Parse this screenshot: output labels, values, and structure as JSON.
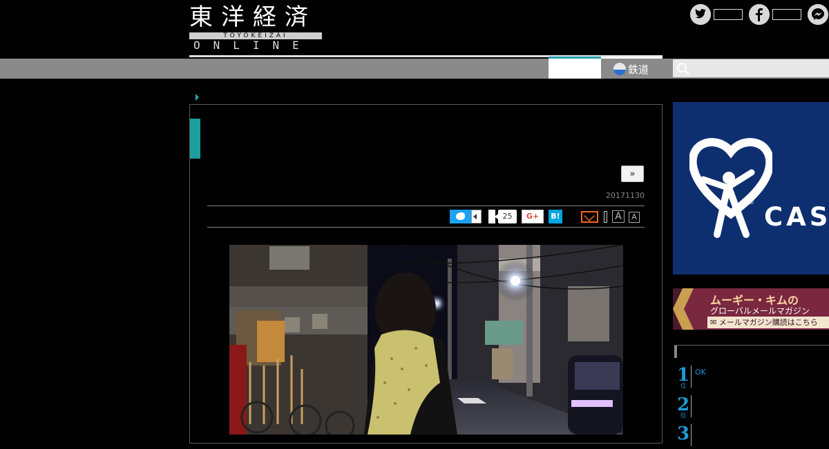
{
  "site": {
    "logo_kanji": "東洋経済",
    "logo_band": "TOYOKEIZAI",
    "logo_online": "ONLINE"
  },
  "social": {
    "twitter_icon": "twitter-icon",
    "facebook_icon": "facebook-icon",
    "messenger_icon": "messenger-icon"
  },
  "nav": {
    "rail_label": "鉄道",
    "search_placeholder": ""
  },
  "article": {
    "next_label": "»",
    "date": "20171130",
    "like_count": "25",
    "gplus_label": "G+",
    "hatena_label": "B!",
    "font_large_label": "A",
    "font_small_label": "A"
  },
  "sidebar": {
    "ad_cas": {
      "word": "CAS",
      "reg": "®"
    },
    "ad_mugi": {
      "line1": "ムーギー・キムの",
      "line2": "グローバルメールマガジン",
      "line3": "✉ メールマガジン購読はこちら"
    },
    "ranking": [
      {
        "rank": "1",
        "suffix": "位",
        "text": "OK"
      },
      {
        "rank": "2",
        "suffix": "位",
        "text": ""
      },
      {
        "rank": "3",
        "suffix": "位",
        "text": ""
      }
    ]
  },
  "colors": {
    "accent_teal": "#1e9e9c",
    "nav_gray": "#8a8a8a",
    "twitter_blue": "#1da1f2",
    "hatena_blue": "#00a4de",
    "mail_orange": "#f36b1a",
    "ranking_blue": "#1e9ad6",
    "cas_navy": "#0e2f6f"
  }
}
